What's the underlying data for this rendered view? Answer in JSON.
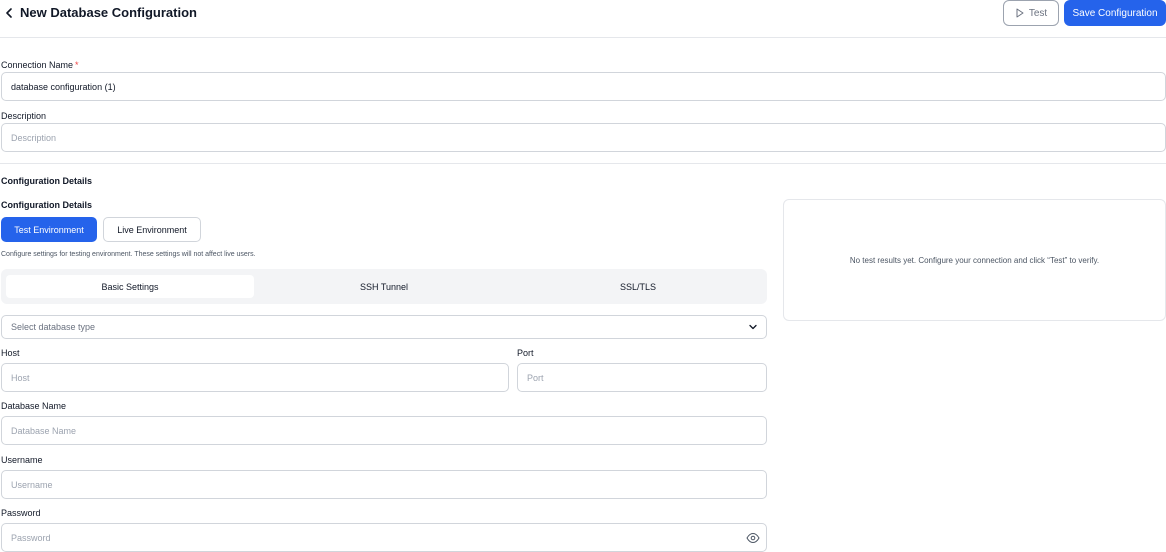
{
  "header": {
    "title": "New Database Configuration",
    "test_label": "Test",
    "save_label": "Save Configuration"
  },
  "form": {
    "connection_name_label": "Connection Name",
    "required_mark": "*",
    "connection_name_value": "database configuration (1)",
    "description_label": "Description",
    "description_placeholder": "Description"
  },
  "config": {
    "section_title": "Configuration Details",
    "subsection_title": "Configuration Details",
    "env_test": "Test Environment",
    "env_live": "Live Environment",
    "helper_text": "Configure settings for testing environment. These settings will not affect live users.",
    "tabs": [
      "Basic Settings",
      "SSH Tunnel",
      "SSL/TLS"
    ],
    "active_tab": "Basic Settings",
    "db_type_placeholder": "Select database type",
    "host_label": "Host",
    "host_placeholder": "Host",
    "port_label": "Port",
    "port_placeholder": "Port",
    "dbname_label": "Database Name",
    "dbname_placeholder": "Database Name",
    "username_label": "Username",
    "username_placeholder": "Username",
    "password_label": "Password",
    "password_placeholder": "Password"
  },
  "results": {
    "empty_message": "No test results yet. Configure your connection and click “Test” to verify."
  },
  "colors": {
    "accent": "#2563eb",
    "required": "#ef4444",
    "border": "#d1d5db",
    "tab_bg": "#f3f4f6"
  },
  "icons": [
    "back-chevron-icon",
    "play-icon",
    "chevron-down-icon",
    "eye-icon"
  ]
}
